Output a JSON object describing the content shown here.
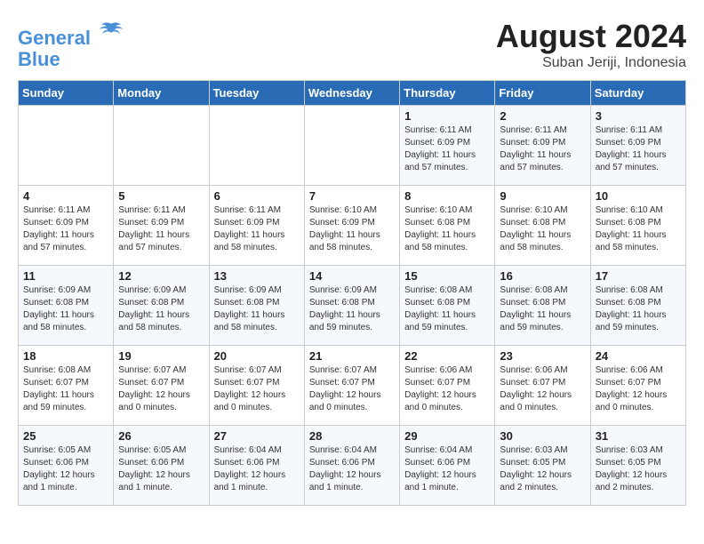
{
  "header": {
    "logo_line1": "General",
    "logo_line2": "Blue",
    "month_title": "August 2024",
    "subtitle": "Suban Jeriji, Indonesia"
  },
  "days_of_week": [
    "Sunday",
    "Monday",
    "Tuesday",
    "Wednesday",
    "Thursday",
    "Friday",
    "Saturday"
  ],
  "weeks": [
    [
      {
        "day": "",
        "info": ""
      },
      {
        "day": "",
        "info": ""
      },
      {
        "day": "",
        "info": ""
      },
      {
        "day": "",
        "info": ""
      },
      {
        "day": "1",
        "info": "Sunrise: 6:11 AM\nSunset: 6:09 PM\nDaylight: 11 hours\nand 57 minutes."
      },
      {
        "day": "2",
        "info": "Sunrise: 6:11 AM\nSunset: 6:09 PM\nDaylight: 11 hours\nand 57 minutes."
      },
      {
        "day": "3",
        "info": "Sunrise: 6:11 AM\nSunset: 6:09 PM\nDaylight: 11 hours\nand 57 minutes."
      }
    ],
    [
      {
        "day": "4",
        "info": "Sunrise: 6:11 AM\nSunset: 6:09 PM\nDaylight: 11 hours\nand 57 minutes."
      },
      {
        "day": "5",
        "info": "Sunrise: 6:11 AM\nSunset: 6:09 PM\nDaylight: 11 hours\nand 57 minutes."
      },
      {
        "day": "6",
        "info": "Sunrise: 6:11 AM\nSunset: 6:09 PM\nDaylight: 11 hours\nand 58 minutes."
      },
      {
        "day": "7",
        "info": "Sunrise: 6:10 AM\nSunset: 6:09 PM\nDaylight: 11 hours\nand 58 minutes."
      },
      {
        "day": "8",
        "info": "Sunrise: 6:10 AM\nSunset: 6:08 PM\nDaylight: 11 hours\nand 58 minutes."
      },
      {
        "day": "9",
        "info": "Sunrise: 6:10 AM\nSunset: 6:08 PM\nDaylight: 11 hours\nand 58 minutes."
      },
      {
        "day": "10",
        "info": "Sunrise: 6:10 AM\nSunset: 6:08 PM\nDaylight: 11 hours\nand 58 minutes."
      }
    ],
    [
      {
        "day": "11",
        "info": "Sunrise: 6:09 AM\nSunset: 6:08 PM\nDaylight: 11 hours\nand 58 minutes."
      },
      {
        "day": "12",
        "info": "Sunrise: 6:09 AM\nSunset: 6:08 PM\nDaylight: 11 hours\nand 58 minutes."
      },
      {
        "day": "13",
        "info": "Sunrise: 6:09 AM\nSunset: 6:08 PM\nDaylight: 11 hours\nand 58 minutes."
      },
      {
        "day": "14",
        "info": "Sunrise: 6:09 AM\nSunset: 6:08 PM\nDaylight: 11 hours\nand 59 minutes."
      },
      {
        "day": "15",
        "info": "Sunrise: 6:08 AM\nSunset: 6:08 PM\nDaylight: 11 hours\nand 59 minutes."
      },
      {
        "day": "16",
        "info": "Sunrise: 6:08 AM\nSunset: 6:08 PM\nDaylight: 11 hours\nand 59 minutes."
      },
      {
        "day": "17",
        "info": "Sunrise: 6:08 AM\nSunset: 6:08 PM\nDaylight: 11 hours\nand 59 minutes."
      }
    ],
    [
      {
        "day": "18",
        "info": "Sunrise: 6:08 AM\nSunset: 6:07 PM\nDaylight: 11 hours\nand 59 minutes."
      },
      {
        "day": "19",
        "info": "Sunrise: 6:07 AM\nSunset: 6:07 PM\nDaylight: 12 hours\nand 0 minutes."
      },
      {
        "day": "20",
        "info": "Sunrise: 6:07 AM\nSunset: 6:07 PM\nDaylight: 12 hours\nand 0 minutes."
      },
      {
        "day": "21",
        "info": "Sunrise: 6:07 AM\nSunset: 6:07 PM\nDaylight: 12 hours\nand 0 minutes."
      },
      {
        "day": "22",
        "info": "Sunrise: 6:06 AM\nSunset: 6:07 PM\nDaylight: 12 hours\nand 0 minutes."
      },
      {
        "day": "23",
        "info": "Sunrise: 6:06 AM\nSunset: 6:07 PM\nDaylight: 12 hours\nand 0 minutes."
      },
      {
        "day": "24",
        "info": "Sunrise: 6:06 AM\nSunset: 6:07 PM\nDaylight: 12 hours\nand 0 minutes."
      }
    ],
    [
      {
        "day": "25",
        "info": "Sunrise: 6:05 AM\nSunset: 6:06 PM\nDaylight: 12 hours\nand 1 minute."
      },
      {
        "day": "26",
        "info": "Sunrise: 6:05 AM\nSunset: 6:06 PM\nDaylight: 12 hours\nand 1 minute."
      },
      {
        "day": "27",
        "info": "Sunrise: 6:04 AM\nSunset: 6:06 PM\nDaylight: 12 hours\nand 1 minute."
      },
      {
        "day": "28",
        "info": "Sunrise: 6:04 AM\nSunset: 6:06 PM\nDaylight: 12 hours\nand 1 minute."
      },
      {
        "day": "29",
        "info": "Sunrise: 6:04 AM\nSunset: 6:06 PM\nDaylight: 12 hours\nand 1 minute."
      },
      {
        "day": "30",
        "info": "Sunrise: 6:03 AM\nSunset: 6:05 PM\nDaylight: 12 hours\nand 2 minutes."
      },
      {
        "day": "31",
        "info": "Sunrise: 6:03 AM\nSunset: 6:05 PM\nDaylight: 12 hours\nand 2 minutes."
      }
    ]
  ]
}
